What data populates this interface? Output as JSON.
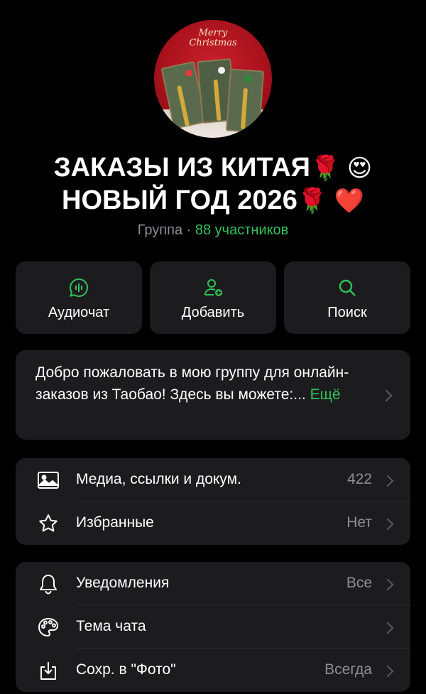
{
  "header": {
    "avatar_caption_line1": "Merry",
    "avatar_caption_line2": "Christmas",
    "title_line1": "ЗАКАЗЫ ИЗ КИТАЯ",
    "title_line1_emoji": "🌹 😍",
    "title_line2": "НОВЫЙ ГОД 2026",
    "title_line2_emoji": "🌹 ❤️",
    "subtitle_type": "Группа · ",
    "subtitle_members": "88 участников"
  },
  "actions": [
    {
      "label": "Аудиочат",
      "icon": "audio-chat-icon"
    },
    {
      "label": "Добавить",
      "icon": "add-member-icon"
    },
    {
      "label": "Поиск",
      "icon": "search-icon"
    }
  ],
  "description": {
    "text": "Добро пожаловать в мою группу для онлайн-заказов из Таобао! Здесь вы можете:... ",
    "more_label": "Ещё"
  },
  "section1": [
    {
      "label": "Медиа, ссылки и докум.",
      "value": "422",
      "icon": "media-icon"
    },
    {
      "label": "Избранные",
      "value": "Нет",
      "icon": "star-icon"
    }
  ],
  "section2": [
    {
      "label": "Уведомления",
      "value": "Все",
      "icon": "bell-icon"
    },
    {
      "label": "Тема чата",
      "value": "",
      "icon": "palette-icon"
    },
    {
      "label": "Сохр. в \"Фото\"",
      "value": "Всегда",
      "icon": "save-to-photos-icon"
    }
  ],
  "colors": {
    "background": "#000000",
    "card": "#1c1c1e",
    "accent": "#30c25a",
    "secondary_text": "#8e8e93"
  }
}
